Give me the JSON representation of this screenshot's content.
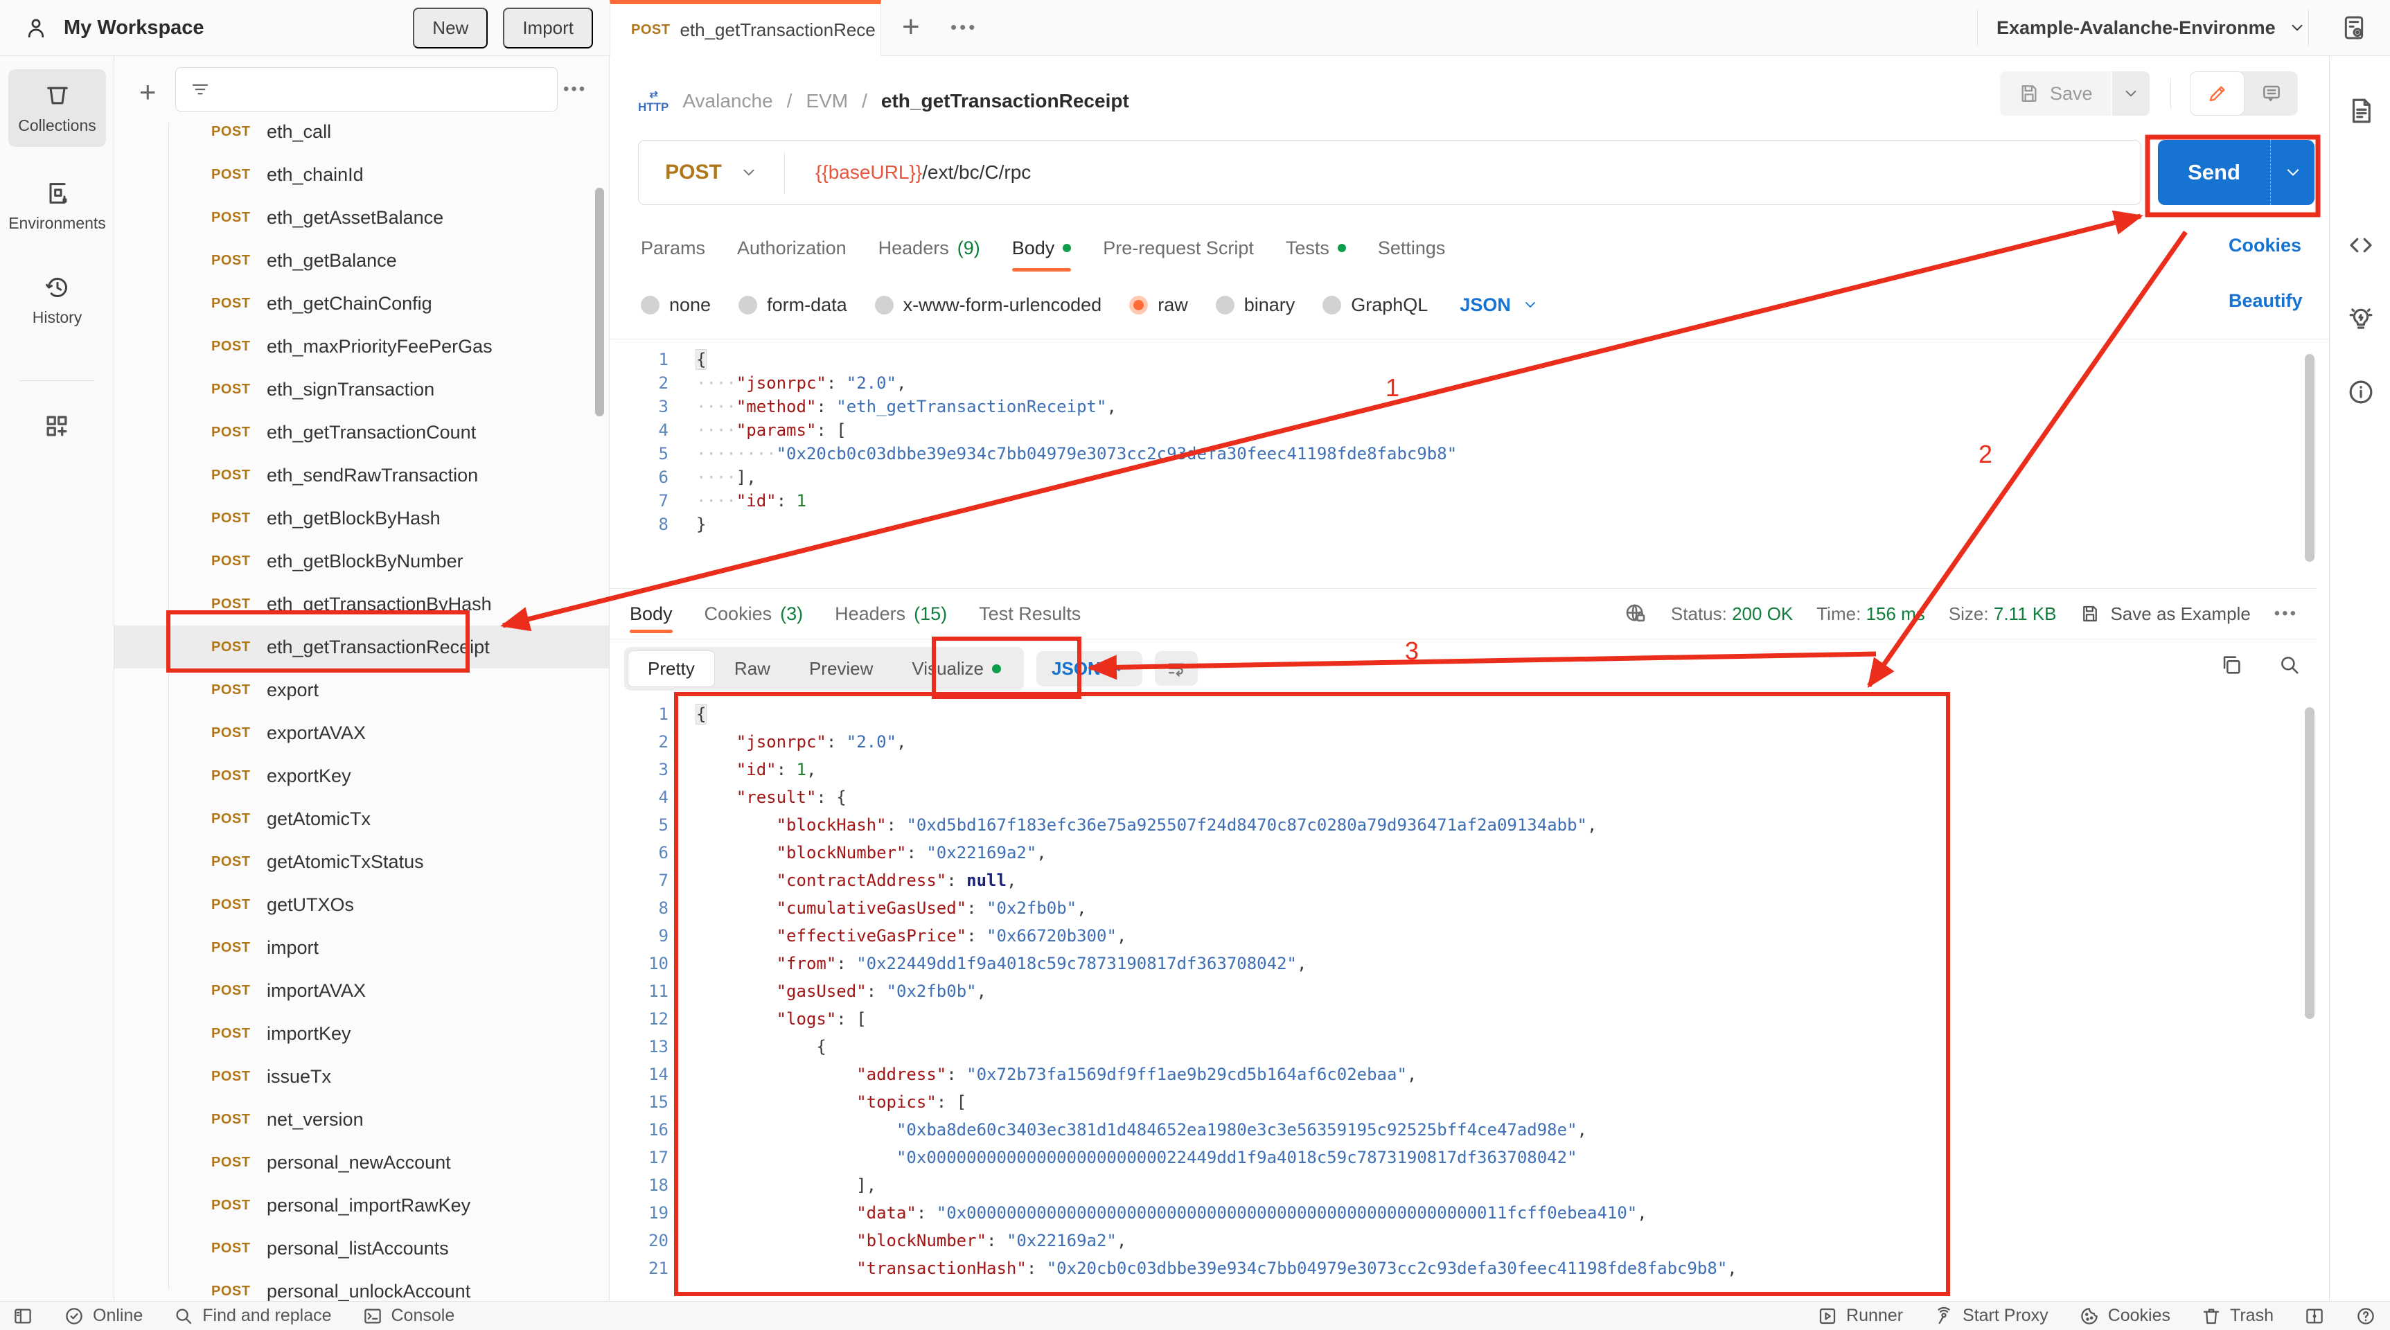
{
  "topbar": {
    "workspace": "My Workspace",
    "new_button": "New",
    "import_button": "Import",
    "tab": {
      "method": "POST",
      "title": "eth_getTransactionRece"
    },
    "environment": "Example-Avalanche-Environme"
  },
  "request": {
    "breadcrumb": {
      "icon_label": "HTTP",
      "part1": "Avalanche",
      "part2": "EVM",
      "current": "eth_getTransactionReceipt"
    },
    "save_button": "Save",
    "method": "POST",
    "url": {
      "variable": "{{baseURL}}",
      "path": "/ext/bc/C/rpc"
    },
    "send_button": "Send",
    "tabs": [
      {
        "label": "Params"
      },
      {
        "label": "Authorization"
      },
      {
        "label": "Headers",
        "count": "(9)"
      },
      {
        "label": "Body",
        "dot": true,
        "active": true
      },
      {
        "label": "Pre-request Script"
      },
      {
        "label": "Tests",
        "dot": true
      },
      {
        "label": "Settings"
      }
    ],
    "cookies_link": "Cookies",
    "modes": [
      {
        "label": "none"
      },
      {
        "label": "form-data"
      },
      {
        "label": "x-www-form-urlencoded"
      },
      {
        "label": "raw",
        "selected": true
      },
      {
        "label": "binary"
      },
      {
        "label": "GraphQL"
      }
    ],
    "language": "JSON",
    "beautify_link": "Beautify",
    "code": {
      "lines": [
        {
          "n": 1,
          "s": [
            {
              "t": "{",
              "c": "p f"
            }
          ]
        },
        {
          "n": 2,
          "s": [
            {
              "t": "····",
              "c": "d"
            },
            {
              "t": "\"jsonrpc\"",
              "c": "k"
            },
            {
              "t": ": ",
              "c": "p"
            },
            {
              "t": "\"2.0\"",
              "c": "s"
            },
            {
              "t": ",",
              "c": "p"
            }
          ]
        },
        {
          "n": 3,
          "s": [
            {
              "t": "····",
              "c": "d"
            },
            {
              "t": "\"method\"",
              "c": "k"
            },
            {
              "t": ": ",
              "c": "p"
            },
            {
              "t": "\"eth_getTransactionReceipt\"",
              "c": "s"
            },
            {
              "t": ",",
              "c": "p"
            }
          ]
        },
        {
          "n": 4,
          "s": [
            {
              "t": "····",
              "c": "d"
            },
            {
              "t": "\"params\"",
              "c": "k"
            },
            {
              "t": ": [",
              "c": "p"
            }
          ]
        },
        {
          "n": 5,
          "s": [
            {
              "t": "········",
              "c": "d"
            },
            {
              "t": "\"0x20cb0c03dbbe39e934c7bb04979e3073cc2c93defa30feec41198fde8fabc9b8\"",
              "c": "s"
            }
          ]
        },
        {
          "n": 6,
          "s": [
            {
              "t": "····",
              "c": "d"
            },
            {
              "t": "],",
              "c": "p"
            }
          ]
        },
        {
          "n": 7,
          "s": [
            {
              "t": "····",
              "c": "d"
            },
            {
              "t": "\"id\"",
              "c": "k"
            },
            {
              "t": ": ",
              "c": "p"
            },
            {
              "t": "1",
              "c": "n"
            }
          ]
        },
        {
          "n": 8,
          "s": [
            {
              "t": "}",
              "c": "p"
            }
          ]
        }
      ]
    }
  },
  "response": {
    "tabs": [
      {
        "label": "Body",
        "active": true
      },
      {
        "label": "Cookies",
        "count": "(3)"
      },
      {
        "label": "Headers",
        "count": "(15)"
      },
      {
        "label": "Test Results"
      }
    ],
    "meta": {
      "status_label": "Status:",
      "status_value": "200 OK",
      "time_label": "Time:",
      "time_value": "156 ms",
      "size_label": "Size:",
      "size_value": "7.11 KB",
      "save_as_example": "Save as Example"
    },
    "views": [
      {
        "label": "Pretty",
        "active": true
      },
      {
        "label": "Raw"
      },
      {
        "label": "Preview"
      },
      {
        "label": "Visualize",
        "dot": true
      }
    ],
    "language": "JSON",
    "code": {
      "lines": [
        {
          "n": 1,
          "s": [
            {
              "t": "{",
              "c": "p f"
            }
          ]
        },
        {
          "n": 2,
          "s": [
            {
              "t": "    ",
              "c": "p"
            },
            {
              "t": "\"jsonrpc\"",
              "c": "k"
            },
            {
              "t": ": ",
              "c": "p"
            },
            {
              "t": "\"2.0\"",
              "c": "s"
            },
            {
              "t": ",",
              "c": "p"
            }
          ]
        },
        {
          "n": 3,
          "s": [
            {
              "t": "    ",
              "c": "p"
            },
            {
              "t": "\"id\"",
              "c": "k"
            },
            {
              "t": ": ",
              "c": "p"
            },
            {
              "t": "1",
              "c": "n"
            },
            {
              "t": ",",
              "c": "p"
            }
          ]
        },
        {
          "n": 4,
          "s": [
            {
              "t": "    ",
              "c": "p"
            },
            {
              "t": "\"result\"",
              "c": "k"
            },
            {
              "t": ": {",
              "c": "p"
            }
          ]
        },
        {
          "n": 5,
          "s": [
            {
              "t": "        ",
              "c": "p"
            },
            {
              "t": "\"blockHash\"",
              "c": "k"
            },
            {
              "t": ": ",
              "c": "p"
            },
            {
              "t": "\"0xd5bd167f183efc36e75a925507f24d8470c87c0280a79d936471af2a09134abb\"",
              "c": "s"
            },
            {
              "t": ",",
              "c": "p"
            }
          ]
        },
        {
          "n": 6,
          "s": [
            {
              "t": "        ",
              "c": "p"
            },
            {
              "t": "\"blockNumber\"",
              "c": "k"
            },
            {
              "t": ": ",
              "c": "p"
            },
            {
              "t": "\"0x22169a2\"",
              "c": "s"
            },
            {
              "t": ",",
              "c": "p"
            }
          ]
        },
        {
          "n": 7,
          "s": [
            {
              "t": "        ",
              "c": "p"
            },
            {
              "t": "\"contractAddress\"",
              "c": "k"
            },
            {
              "t": ": ",
              "c": "p"
            },
            {
              "t": "null",
              "c": "b"
            },
            {
              "t": ",",
              "c": "p"
            }
          ]
        },
        {
          "n": 8,
          "s": [
            {
              "t": "        ",
              "c": "p"
            },
            {
              "t": "\"cumulativeGasUsed\"",
              "c": "k"
            },
            {
              "t": ": ",
              "c": "p"
            },
            {
              "t": "\"0x2fb0b\"",
              "c": "s"
            },
            {
              "t": ",",
              "c": "p"
            }
          ]
        },
        {
          "n": 9,
          "s": [
            {
              "t": "        ",
              "c": "p"
            },
            {
              "t": "\"effectiveGasPrice\"",
              "c": "k"
            },
            {
              "t": ": ",
              "c": "p"
            },
            {
              "t": "\"0x66720b300\"",
              "c": "s"
            },
            {
              "t": ",",
              "c": "p"
            }
          ]
        },
        {
          "n": 10,
          "s": [
            {
              "t": "        ",
              "c": "p"
            },
            {
              "t": "\"from\"",
              "c": "k"
            },
            {
              "t": ": ",
              "c": "p"
            },
            {
              "t": "\"0x22449dd1f9a4018c59c7873190817df363708042\"",
              "c": "s"
            },
            {
              "t": ",",
              "c": "p"
            }
          ]
        },
        {
          "n": 11,
          "s": [
            {
              "t": "        ",
              "c": "p"
            },
            {
              "t": "\"gasUsed\"",
              "c": "k"
            },
            {
              "t": ": ",
              "c": "p"
            },
            {
              "t": "\"0x2fb0b\"",
              "c": "s"
            },
            {
              "t": ",",
              "c": "p"
            }
          ]
        },
        {
          "n": 12,
          "s": [
            {
              "t": "        ",
              "c": "p"
            },
            {
              "t": "\"logs\"",
              "c": "k"
            },
            {
              "t": ": [",
              "c": "p"
            }
          ]
        },
        {
          "n": 13,
          "s": [
            {
              "t": "            {",
              "c": "p"
            }
          ]
        },
        {
          "n": 14,
          "s": [
            {
              "t": "                ",
              "c": "p"
            },
            {
              "t": "\"address\"",
              "c": "k"
            },
            {
              "t": ": ",
              "c": "p"
            },
            {
              "t": "\"0x72b73fa1569df9ff1ae9b29cd5b164af6c02ebaa\"",
              "c": "s"
            },
            {
              "t": ",",
              "c": "p"
            }
          ]
        },
        {
          "n": 15,
          "s": [
            {
              "t": "                ",
              "c": "p"
            },
            {
              "t": "\"topics\"",
              "c": "k"
            },
            {
              "t": ": [",
              "c": "p"
            }
          ]
        },
        {
          "n": 16,
          "s": [
            {
              "t": "                    ",
              "c": "p"
            },
            {
              "t": "\"0xba8de60c3403ec381d1d484652ea1980e3c3e56359195c92525bff4ce47ad98e\"",
              "c": "s"
            },
            {
              "t": ",",
              "c": "p"
            }
          ]
        },
        {
          "n": 17,
          "s": [
            {
              "t": "                    ",
              "c": "p"
            },
            {
              "t": "\"0x00000000000000000000000022449dd1f9a4018c59c7873190817df363708042\"",
              "c": "s"
            }
          ]
        },
        {
          "n": 18,
          "s": [
            {
              "t": "                ",
              "c": "p"
            },
            {
              "t": "],",
              "c": "p"
            }
          ]
        },
        {
          "n": 19,
          "s": [
            {
              "t": "                ",
              "c": "p"
            },
            {
              "t": "\"data\"",
              "c": "k"
            },
            {
              "t": ": ",
              "c": "p"
            },
            {
              "t": "\"0x000000000000000000000000000000000000000000000000000011fcff0ebea410\"",
              "c": "s"
            },
            {
              "t": ",",
              "c": "p"
            }
          ]
        },
        {
          "n": 20,
          "s": [
            {
              "t": "                ",
              "c": "p"
            },
            {
              "t": "\"blockNumber\"",
              "c": "k"
            },
            {
              "t": ": ",
              "c": "p"
            },
            {
              "t": "\"0x22169a2\"",
              "c": "s"
            },
            {
              "t": ",",
              "c": "p"
            }
          ]
        },
        {
          "n": 21,
          "s": [
            {
              "t": "                ",
              "c": "p"
            },
            {
              "t": "\"transactionHash\"",
              "c": "k"
            },
            {
              "t": ": ",
              "c": "p"
            },
            {
              "t": "\"0x20cb0c03dbbe39e934c7bb04979e3073cc2c93defa30feec41198fde8fabc9b8\"",
              "c": "s"
            },
            {
              "t": ",",
              "c": "p"
            }
          ]
        }
      ]
    }
  },
  "sidebar": {
    "rail": [
      {
        "label": "Collections"
      },
      {
        "label": "Environments"
      },
      {
        "label": "History"
      }
    ],
    "items": [
      {
        "method": "POST",
        "name": "eth_call"
      },
      {
        "method": "POST",
        "name": "eth_chainId"
      },
      {
        "method": "POST",
        "name": "eth_getAssetBalance"
      },
      {
        "method": "POST",
        "name": "eth_getBalance"
      },
      {
        "method": "POST",
        "name": "eth_getChainConfig"
      },
      {
        "method": "POST",
        "name": "eth_maxPriorityFeePerGas"
      },
      {
        "method": "POST",
        "name": "eth_signTransaction"
      },
      {
        "method": "POST",
        "name": "eth_getTransactionCount"
      },
      {
        "method": "POST",
        "name": "eth_sendRawTransaction"
      },
      {
        "method": "POST",
        "name": "eth_getBlockByHash"
      },
      {
        "method": "POST",
        "name": "eth_getBlockByNumber"
      },
      {
        "method": "POST",
        "name": "eth_getTransactionByHash"
      },
      {
        "method": "POST",
        "name": "eth_getTransactionReceipt",
        "selected": true
      },
      {
        "method": "POST",
        "name": "export"
      },
      {
        "method": "POST",
        "name": "exportAVAX"
      },
      {
        "method": "POST",
        "name": "exportKey"
      },
      {
        "method": "POST",
        "name": "getAtomicTx"
      },
      {
        "method": "POST",
        "name": "getAtomicTxStatus"
      },
      {
        "method": "POST",
        "name": "getUTXOs"
      },
      {
        "method": "POST",
        "name": "import"
      },
      {
        "method": "POST",
        "name": "importAVAX"
      },
      {
        "method": "POST",
        "name": "importKey"
      },
      {
        "method": "POST",
        "name": "issueTx"
      },
      {
        "method": "POST",
        "name": "net_version"
      },
      {
        "method": "POST",
        "name": "personal_newAccount"
      },
      {
        "method": "POST",
        "name": "personal_importRawKey"
      },
      {
        "method": "POST",
        "name": "personal_listAccounts"
      },
      {
        "method": "POST",
        "name": "personal_unlockAccount"
      }
    ]
  },
  "statusbar": {
    "online": "Online",
    "find": "Find and replace",
    "console": "Console",
    "runner": "Runner",
    "proxy": "Start Proxy",
    "cookies": "Cookies",
    "trash": "Trash"
  },
  "annotations": {
    "labels": [
      "1",
      "2",
      "3"
    ],
    "color": "#eb2d1c"
  }
}
